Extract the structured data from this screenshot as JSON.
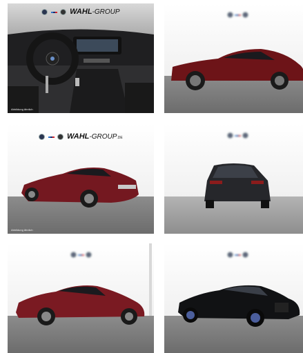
{
  "brand": {
    "dealer_name": "WAHL",
    "dealer_suffix": "-GROUP",
    "dealer_tld": ".DE"
  },
  "tiles": [
    {
      "name": "interior-cockpit",
      "caption": "Abbildung ähnlich",
      "bg": "#3a3a3a"
    },
    {
      "name": "exterior-side-red",
      "body_color": "#6d1418"
    },
    {
      "name": "exterior-rear-three-quarter-red",
      "caption": "Abbildung ähnlich",
      "body_color": "#741820"
    },
    {
      "name": "exterior-rear-dark",
      "body_color": "#26272b"
    },
    {
      "name": "exterior-side-front-red",
      "body_color": "#7a1a22"
    },
    {
      "name": "exterior-front-three-quarter-black",
      "body_color": "#111214"
    }
  ]
}
